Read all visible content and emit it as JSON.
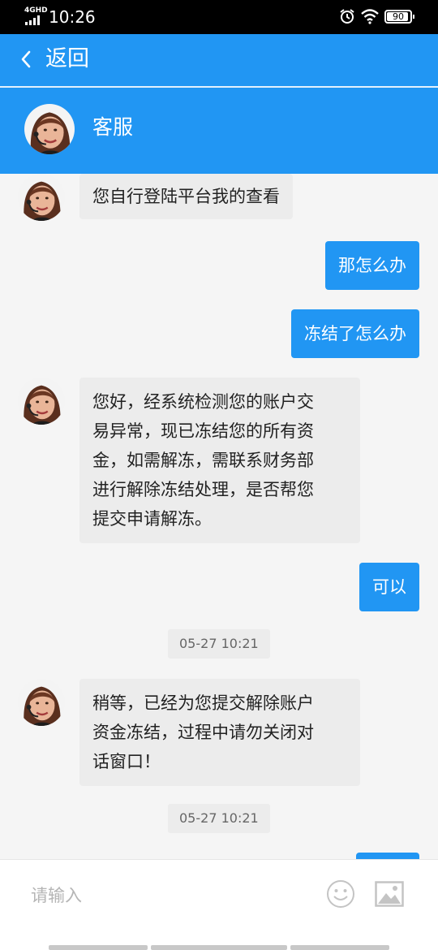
{
  "status_bar": {
    "network": "4GHD",
    "time": "10:26",
    "battery": "90",
    "icons": [
      "signal-icon",
      "alarm-icon",
      "wifi-icon",
      "battery-icon"
    ]
  },
  "nav": {
    "back_label": "返回",
    "back_icon": "chevron-left-icon"
  },
  "agent": {
    "name": "客服",
    "avatar": "agent-headset-avatar"
  },
  "messages": [
    {
      "from": "agent",
      "text": "您自行登陆平台我的查看"
    },
    {
      "from": "user",
      "text": "那怎么办"
    },
    {
      "from": "user",
      "text": "冻结了怎么办"
    },
    {
      "from": "agent",
      "lines": [
        "您好，经系统检测您的账户交",
        "易异常，现已冻结您的所有资",
        "金，如需解冻，需联系财务部",
        "进行解除冻结处理，是否帮您",
        "提交申请解冻。"
      ]
    },
    {
      "from": "user",
      "text": "可以"
    },
    {
      "from": "time",
      "text": "05-27 10:21"
    },
    {
      "from": "agent",
      "lines": [
        "稍等，已经为您提交解除账户",
        "资金冻结，过程中请勿关闭对",
        "话窗口！"
      ]
    },
    {
      "from": "time",
      "text": "05-27 10:21"
    }
  ],
  "input": {
    "placeholder": "请输入",
    "value": "",
    "emoji_icon": "smiley-icon",
    "image_icon": "image-icon"
  },
  "colors": {
    "primary": "#2196f3",
    "agent_bubble": "#ececec",
    "background": "#f5f5f5"
  }
}
